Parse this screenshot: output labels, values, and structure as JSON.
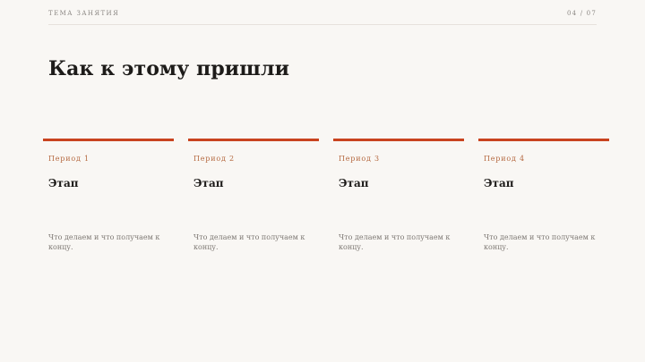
{
  "header": {
    "topic": "ТЕМА ЗАНЯТИЯ",
    "page_indicator": "04 / 07"
  },
  "slide": {
    "title": "Как к этому пришли"
  },
  "colors": {
    "accent": "#c9431f",
    "period_text": "#b56940",
    "background": "#f9f7f4"
  },
  "timeline": {
    "items": [
      {
        "period": "Период 1",
        "stage": "Этап",
        "description": "Что делаем и что получаем к концу."
      },
      {
        "period": "Период 2",
        "stage": "Этап",
        "description": "Что делаем и что получаем к концу."
      },
      {
        "period": "Период 3",
        "stage": "Этап",
        "description": "Что делаем и что получаем к концу."
      },
      {
        "period": "Период 4",
        "stage": "Этап",
        "description": "Что делаем и что получаем к концу."
      }
    ]
  }
}
